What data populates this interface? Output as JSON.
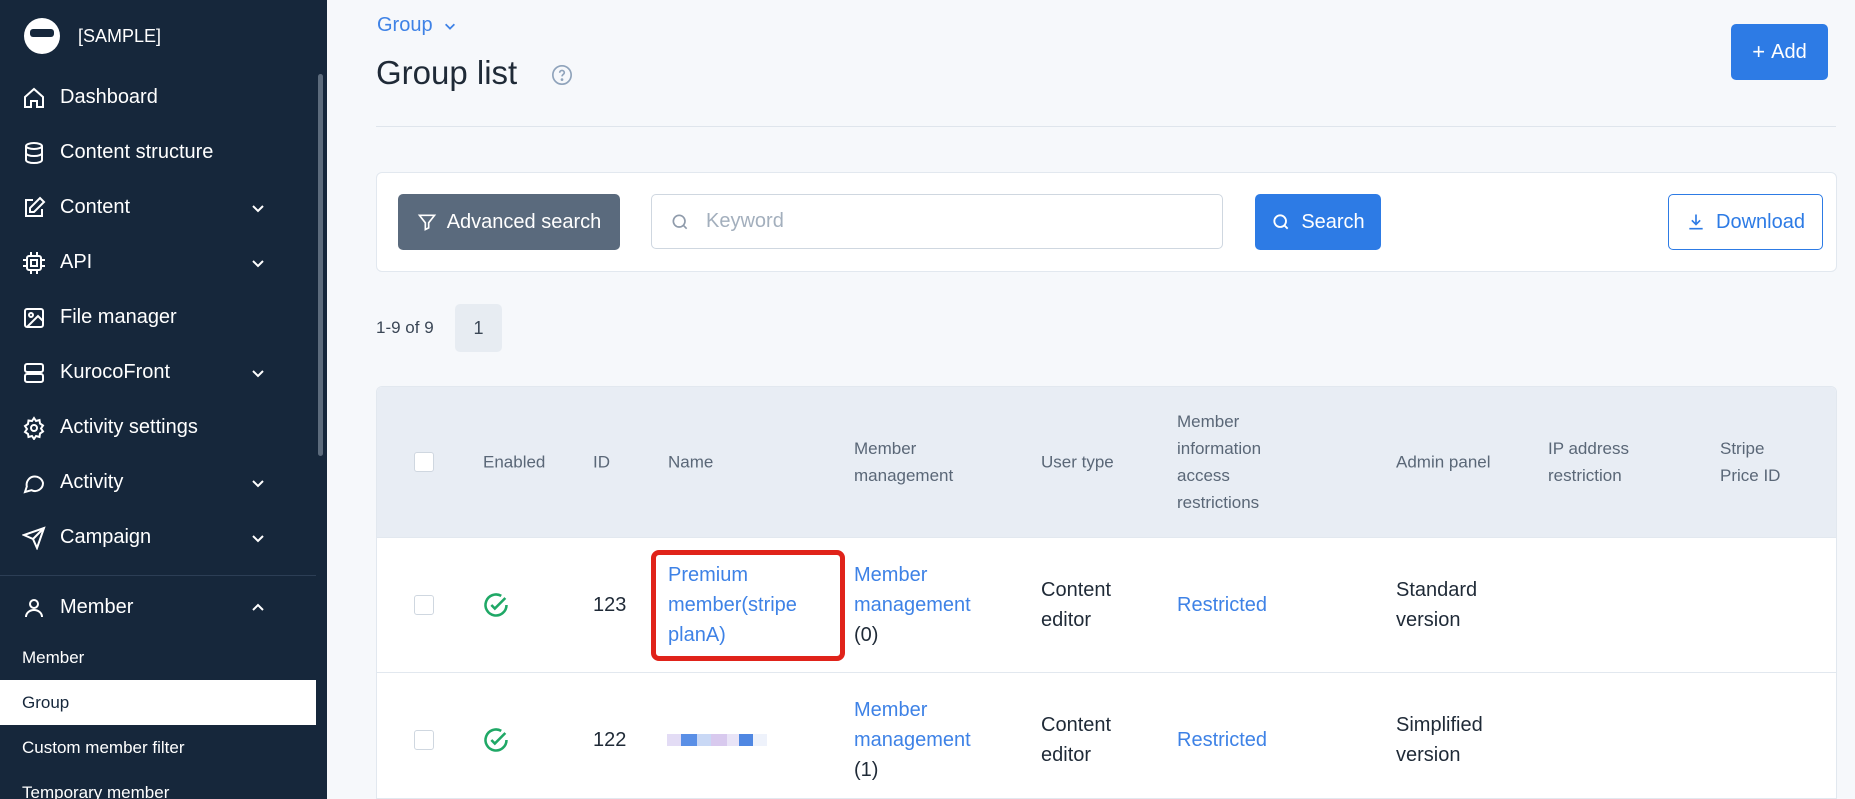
{
  "sidebar": {
    "brand": "[SAMPLE]",
    "items": [
      {
        "label": "Dashboard"
      },
      {
        "label": "Content structure"
      },
      {
        "label": "Content"
      },
      {
        "label": "API"
      },
      {
        "label": "File manager"
      },
      {
        "label": "KurocoFront"
      },
      {
        "label": "Activity settings"
      },
      {
        "label": "Activity"
      },
      {
        "label": "Campaign"
      }
    ],
    "member": {
      "label": "Member",
      "subitems": [
        "Member",
        "Group",
        "Custom member filter",
        "Temporary member"
      ]
    }
  },
  "header": {
    "breadcrumb": "Group",
    "title": "Group list",
    "add_label": "Add"
  },
  "search": {
    "advanced_label": "Advanced search",
    "keyword_placeholder": "Keyword",
    "search_label": "Search",
    "download_label": "Download"
  },
  "pagination": {
    "info": "1-9 of 9",
    "current_page": "1"
  },
  "table": {
    "columns": {
      "enabled": "Enabled",
      "id": "ID",
      "name": "Name",
      "member_management": [
        "Member",
        "management"
      ],
      "user_type": "User type",
      "member_info": [
        "Member",
        "information",
        "access",
        "restrictions"
      ],
      "admin_panel": "Admin panel",
      "ip_restriction": [
        "IP address",
        "restriction"
      ],
      "stripe_price": [
        "Stripe",
        "Price ID"
      ]
    },
    "rows": [
      {
        "id": "123",
        "name": [
          "Premium",
          "member(stripe",
          "planA)"
        ],
        "member_management": [
          "Member",
          "management",
          "(0)"
        ],
        "user_type": [
          "Content",
          "editor"
        ],
        "member_info": "Restricted",
        "admin_panel": [
          "Standard",
          "version"
        ]
      },
      {
        "id": "122",
        "member_management": [
          "Member",
          "management",
          "(1)"
        ],
        "user_type": [
          "Content",
          "editor"
        ],
        "member_info": "Restricted",
        "admin_panel": [
          "Simplified",
          "version"
        ]
      }
    ]
  },
  "colors": {
    "sidebar_bg": "#16273b",
    "primary": "#2d7be5",
    "link": "#3e82e6",
    "success": "#1fa866",
    "highlight": "#e0231a"
  }
}
